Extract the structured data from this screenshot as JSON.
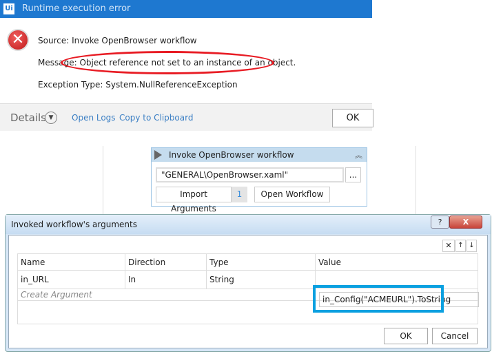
{
  "error_dialog": {
    "logo": "Ui",
    "title": "Runtime execution error",
    "icon": "error-icon",
    "source": "Source: Invoke OpenBrowser workflow",
    "message": "Message: Object reference not set to an instance of an object.",
    "exception": "Exception Type: System.NullReferenceException",
    "details": "Details",
    "open_logs": "Open Logs",
    "copy": "Copy to Clipboard",
    "ok": "OK"
  },
  "activity": {
    "title": "Invoke OpenBrowser workflow",
    "path": "\"GENERAL\\OpenBrowser.xaml\"",
    "browse": "...",
    "import": "Import Arguments",
    "count": "1",
    "open": "Open Workflow"
  },
  "args_dialog": {
    "title": "Invoked workflow's arguments",
    "help": "?",
    "close": "X",
    "columns": [
      "Name",
      "Direction",
      "Type",
      "Value"
    ],
    "rows": [
      {
        "name": "in_URL",
        "direction": "In",
        "type": "String",
        "value": "in_Config(\"ACMEURL\").ToString"
      }
    ],
    "create": "Create Argument",
    "ok": "OK",
    "cancel": "Cancel"
  },
  "colors": {
    "title_bar": "#1e78d0",
    "highlight_ellipse": "#e81c24",
    "highlight_box": "#0aa0e0"
  }
}
